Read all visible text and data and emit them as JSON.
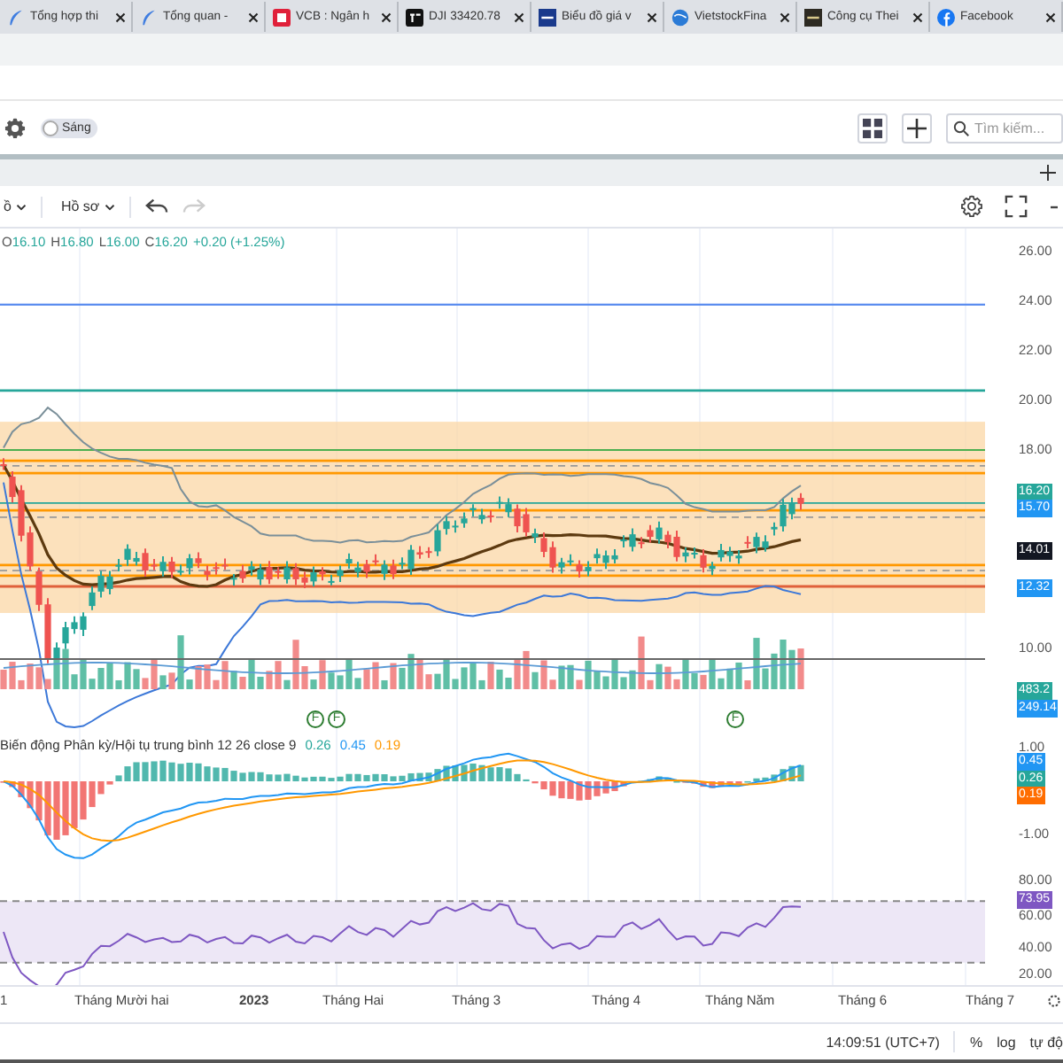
{
  "browser_tabs": [
    {
      "kind": "feather",
      "title": "Tổng hợp thi"
    },
    {
      "kind": "feather",
      "title": "Tổng quan -"
    },
    {
      "kind": "red-square",
      "title": "VCB : Ngân h"
    },
    {
      "kind": "black-square",
      "title": "DJI 33420.78"
    },
    {
      "kind": "blue-square",
      "title": "Biểu đồ giá v"
    },
    {
      "kind": "globe",
      "title": "VietstockFina"
    },
    {
      "kind": "dark-square",
      "title": "Công cụ Thei"
    },
    {
      "kind": "facebook",
      "title": "Facebook"
    }
  ],
  "toolbar": {
    "theme_toggle": {
      "label": "Sáng",
      "on": false
    },
    "search": {
      "placeholder": "Tìm kiếm..."
    }
  },
  "chart_toolbar": {
    "menus": [
      "ồ",
      "Hồ sơ"
    ]
  },
  "legend": {
    "items": [
      {
        "label": "O",
        "value": "16.10"
      },
      {
        "label": "H",
        "value": "16.80"
      },
      {
        "label": "L",
        "value": "16.00"
      },
      {
        "label": "C",
        "value": "16.20"
      }
    ],
    "change": "+0.20 (+1.25%)"
  },
  "price_axis": {
    "ticks": [
      "26.00",
      "24.00",
      "22.00",
      "20.00",
      "18.00",
      "10.00"
    ],
    "badges": [
      {
        "text": "16.20",
        "color": "#26a69a"
      },
      {
        "text": "15.70",
        "color": "#2196f3"
      },
      {
        "text": "14.01",
        "color": "#131722"
      },
      {
        "text": "12.32",
        "color": "#2196f3"
      },
      {
        "text": "483.2",
        "color": "#26a69a"
      },
      {
        "text": "249.14",
        "color": "#2196f3"
      }
    ]
  },
  "event_markers": [
    {
      "label": "F"
    },
    {
      "label": "F"
    },
    {
      "label": "F"
    }
  ],
  "macd": {
    "title": "Biến động Phân kỳ/Hội tụ trung bình 12 26 close 9",
    "values": [
      {
        "text": "0.26",
        "color": "#26a69a"
      },
      {
        "text": "0.45",
        "color": "#2196f3"
      },
      {
        "text": "0.19",
        "color": "#ff9800"
      }
    ],
    "ticks": [
      "1.00",
      "-1.00"
    ],
    "badges": [
      {
        "text": "0.45",
        "color": "#2196f3"
      },
      {
        "text": "0.26",
        "color": "#26a69a"
      },
      {
        "text": "0.19",
        "color": "#ff6d00"
      }
    ]
  },
  "rsi": {
    "ticks": [
      "80.00",
      "60.00",
      "40.00",
      "20.00"
    ],
    "badges": [
      {
        "text": "73.95",
        "color": "#7e57c2"
      }
    ]
  },
  "time_axis": [
    {
      "text": "1",
      "kind": "month"
    },
    {
      "text": "Tháng Mười hai",
      "kind": "month"
    },
    {
      "text": "2023",
      "kind": "year"
    },
    {
      "text": "Tháng Hai",
      "kind": "month"
    },
    {
      "text": "Tháng 3",
      "kind": "month"
    },
    {
      "text": "Tháng 4",
      "kind": "month"
    },
    {
      "text": "Tháng Năm",
      "kind": "month"
    },
    {
      "text": "Tháng 6",
      "kind": "month"
    },
    {
      "text": "Tháng 7",
      "kind": "month"
    }
  ],
  "status_bar": {
    "time": "14:09:51 (UTC+7)",
    "buttons": [
      "%",
      "log",
      "tự độ"
    ]
  }
}
